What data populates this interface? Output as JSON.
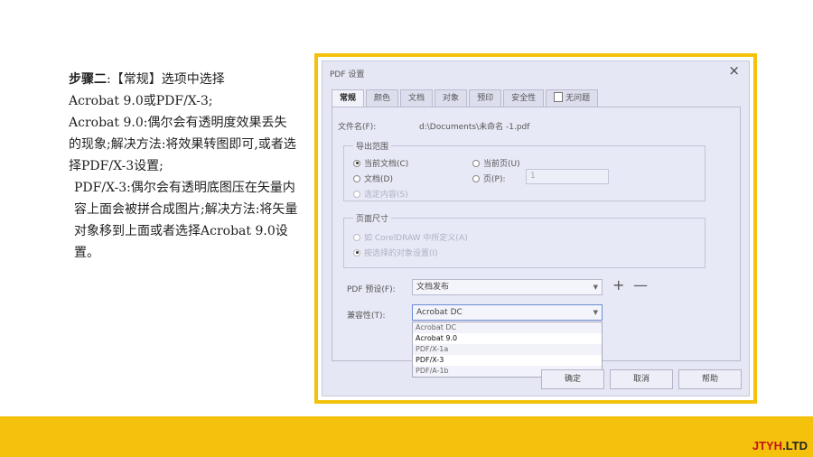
{
  "instructions": {
    "step_title": "步骤二",
    "line1_rest": ":【常规】选项中选择",
    "line2": "Acrobat 9.0或PDF/X-3;",
    "line3": "Acrobat 9.0:偶尔会有透明度效果丢失的现象;解决方法:将效果转图即可,或者选择PDF/X-3设置;",
    "line4": "PDF/X-3:偶尔会有透明底图压在矢量内容上面会被拼合成图片;解决方法:将矢量对象移到上面或者选择Acrobat 9.0设置。"
  },
  "dialog": {
    "title": "PDF 设置",
    "close_icon": "×",
    "tabs": [
      {
        "label": "常规",
        "active": true
      },
      {
        "label": "颜色"
      },
      {
        "label": "文档"
      },
      {
        "label": "对象"
      },
      {
        "label": "预印"
      },
      {
        "label": "安全性"
      },
      {
        "label": "无问题",
        "icon": "document-icon"
      }
    ],
    "filename_label": "文件名(F):",
    "filename_value": "d:\\Documents\\未命名 -1.pdf",
    "export_range": {
      "title": "导出范围",
      "current_doc": "当前文档(C)",
      "current_page": "当前页(U)",
      "documents": "文档(D)",
      "pages": "页(P):",
      "pages_value": "1",
      "selection": "选定内容(S)"
    },
    "page_size": {
      "title": "页面尺寸",
      "as_coreldraw": "如 CorelDRAW 中所定义(A)",
      "as_selected": "按选择的对象设置(I)"
    },
    "preset_label": "PDF 预设(F):",
    "preset_value": "文档发布",
    "plus": "+",
    "minus": "—",
    "compat_label": "兼容性(T):",
    "compat_value": "Acrobat DC",
    "compat_options": [
      "Acrobat DC",
      "Acrobat 9.0",
      "PDF/X-1a",
      "PDF/X-3",
      "PDF/A-1b"
    ],
    "compat_highlighted": [
      "Acrobat 9.0",
      "PDF/X-3"
    ],
    "buttons": {
      "ok": "确定",
      "cancel": "取消",
      "help": "帮助"
    }
  },
  "colors": {
    "accent_yellow": "#f4c20d",
    "brand_red": "#c0121a"
  },
  "brand": {
    "name": "JTYH",
    "suffix": ".LTD"
  }
}
